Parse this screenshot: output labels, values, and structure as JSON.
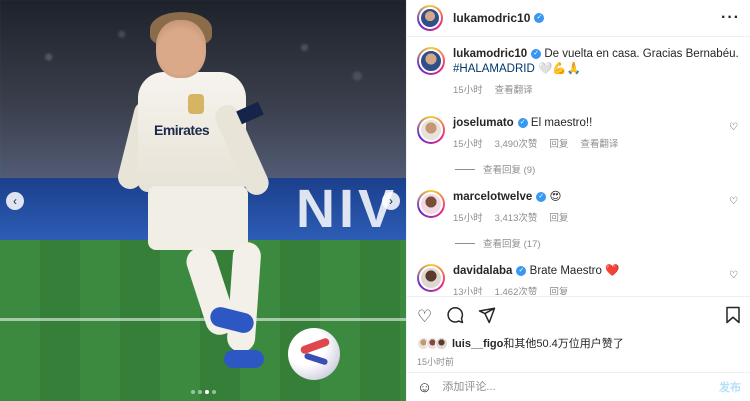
{
  "header": {
    "username": "lukamodric10"
  },
  "media": {
    "banner_text": "NIV",
    "sponsor_text": "Emirates",
    "slides": 4,
    "active_slide": 3
  },
  "caption": {
    "username": "lukamodric10",
    "text": "De vuelta en casa. Gracias Bernabéu.",
    "hashtag": "#HALAMADRID",
    "emojis": "🤍💪🙏",
    "time": "15小时",
    "translate": "查看翻译"
  },
  "comments": [
    {
      "username": "joselumato",
      "text": "El maestro!!",
      "time": "15小时",
      "likes": "3,490次赞",
      "reply": "回复",
      "translate": "查看翻译",
      "replies": "查看回复 (9)"
    },
    {
      "username": "marcelotwelve",
      "text": "😍",
      "time": "15小时",
      "likes": "3,413次赞",
      "reply": "回复",
      "replies": "查看回复 (17)"
    },
    {
      "username": "davidalaba",
      "text": "Brate Maestro ❤️",
      "time": "13小时",
      "likes": "1,462次赞",
      "reply": "回复"
    }
  ],
  "likes_summary": {
    "first_user": "luis__figo",
    "rest": "和其他50.4万位用户赞了"
  },
  "post_time": "15小时前",
  "comment_input": {
    "placeholder": "添加评论...",
    "post_label": "发布"
  },
  "icons": {
    "more": "more-icon",
    "heart": "heart-icon",
    "comment": "comment-icon",
    "share": "share-icon",
    "bookmark": "bookmark-icon",
    "emoji": "emoji-icon",
    "prev": "chevron-left-icon",
    "next": "chevron-right-icon"
  },
  "colors": {
    "verified": "#3897f0",
    "hashtag": "#00376b",
    "post_button": "#b2dffc"
  }
}
